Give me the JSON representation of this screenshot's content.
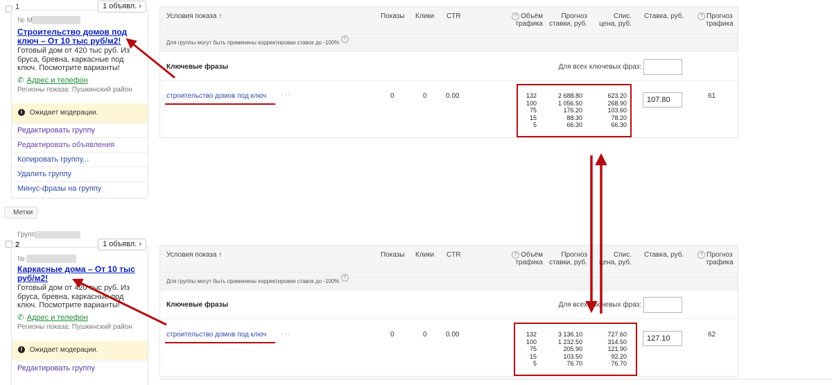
{
  "groups": [
    {
      "number": "1",
      "ads_button": "1 объявл.",
      "ad_number_prefix": "№ М",
      "ad_title": "Строительство домов под ключ – От 10 тыс руб/м2!",
      "ad_text": "Готовый дом от 420 тыс руб. Из бруса, бревна, каркасные под ключ. Посмотрите варианты!",
      "address_link": "Адрес и телефон",
      "regions": "Регионы показа: Пушкинский район",
      "moderation": "Ожидает модерации.",
      "menu": [
        "Редактировать группу",
        "Редактировать объявления",
        "Копировать группу...",
        "Удалить группу",
        "Минус-фразы на группу"
      ]
    },
    {
      "number": "2",
      "group_label_prefix": "Групп",
      "ads_button": "1 объявл.",
      "ad_number_prefix": "№",
      "ad_title": "Каркасные дома – От 10 тыс руб/м2!",
      "ad_text": "Готовый дом от 420 тыс руб. Из бруса, бревна, каркасные под ключ. Посмотрите варианты!",
      "address_link": "Адрес и телефон",
      "regions": "Регионы показа: Пушкинский район",
      "moderation": "Ожидает модерации.",
      "menu": [
        "Редактировать группу"
      ]
    }
  ],
  "labels_tag": "Метки",
  "table_headers": {
    "conditions": "Условия показа ↑",
    "impressions": "Показы",
    "clicks": "Клики",
    "ctr": "CTR",
    "traffic_volume": [
      "Объём",
      "трафика"
    ],
    "bid_forecast": [
      "Прогноз",
      "ставки, руб."
    ],
    "charged_price": [
      "Спис.",
      "цена, руб."
    ],
    "bid": "Ставка, руб.",
    "traffic_forecast": [
      "Прогноз",
      "трафика"
    ]
  },
  "note": "Для группы могут быть применены корректировки ставок до -100%",
  "keywords_header": "Ключевые фразы",
  "for_all_keywords": "Для всех ключевых фраз:",
  "panels": [
    {
      "keyword": "строительство домов под ключ",
      "impressions": "0",
      "clicks": "0",
      "ctr": "0.00",
      "traffic": [
        "132",
        "100",
        "75",
        "15",
        "5"
      ],
      "bid_forecast": [
        "2 688.80",
        "1 056.50",
        "176.20",
        "88.30",
        "66.30"
      ],
      "charged_price": [
        "623.20",
        "268.90",
        "103.60",
        "78.20",
        "66.30"
      ],
      "bid": "107.80",
      "traffic_forecast": "61"
    },
    {
      "keyword": "строительство домов под ключ",
      "impressions": "0",
      "clicks": "0",
      "ctr": "0.00",
      "traffic": [
        "132",
        "100",
        "75",
        "15",
        "5"
      ],
      "bid_forecast": [
        "3 136.10",
        "1 232.50",
        "205.90",
        "103.50",
        "76.70"
      ],
      "charged_price": [
        "727.60",
        "314.50",
        "121.90",
        "92.20",
        "76.70"
      ],
      "bid": "127.10",
      "traffic_forecast": "62"
    }
  ],
  "colors": {
    "annotation_red": "#b30d12",
    "ad_title_blue": "#0a1fb4",
    "menu_purple": "#5a3aa6",
    "moderation_bg": "#fdf7d8"
  }
}
